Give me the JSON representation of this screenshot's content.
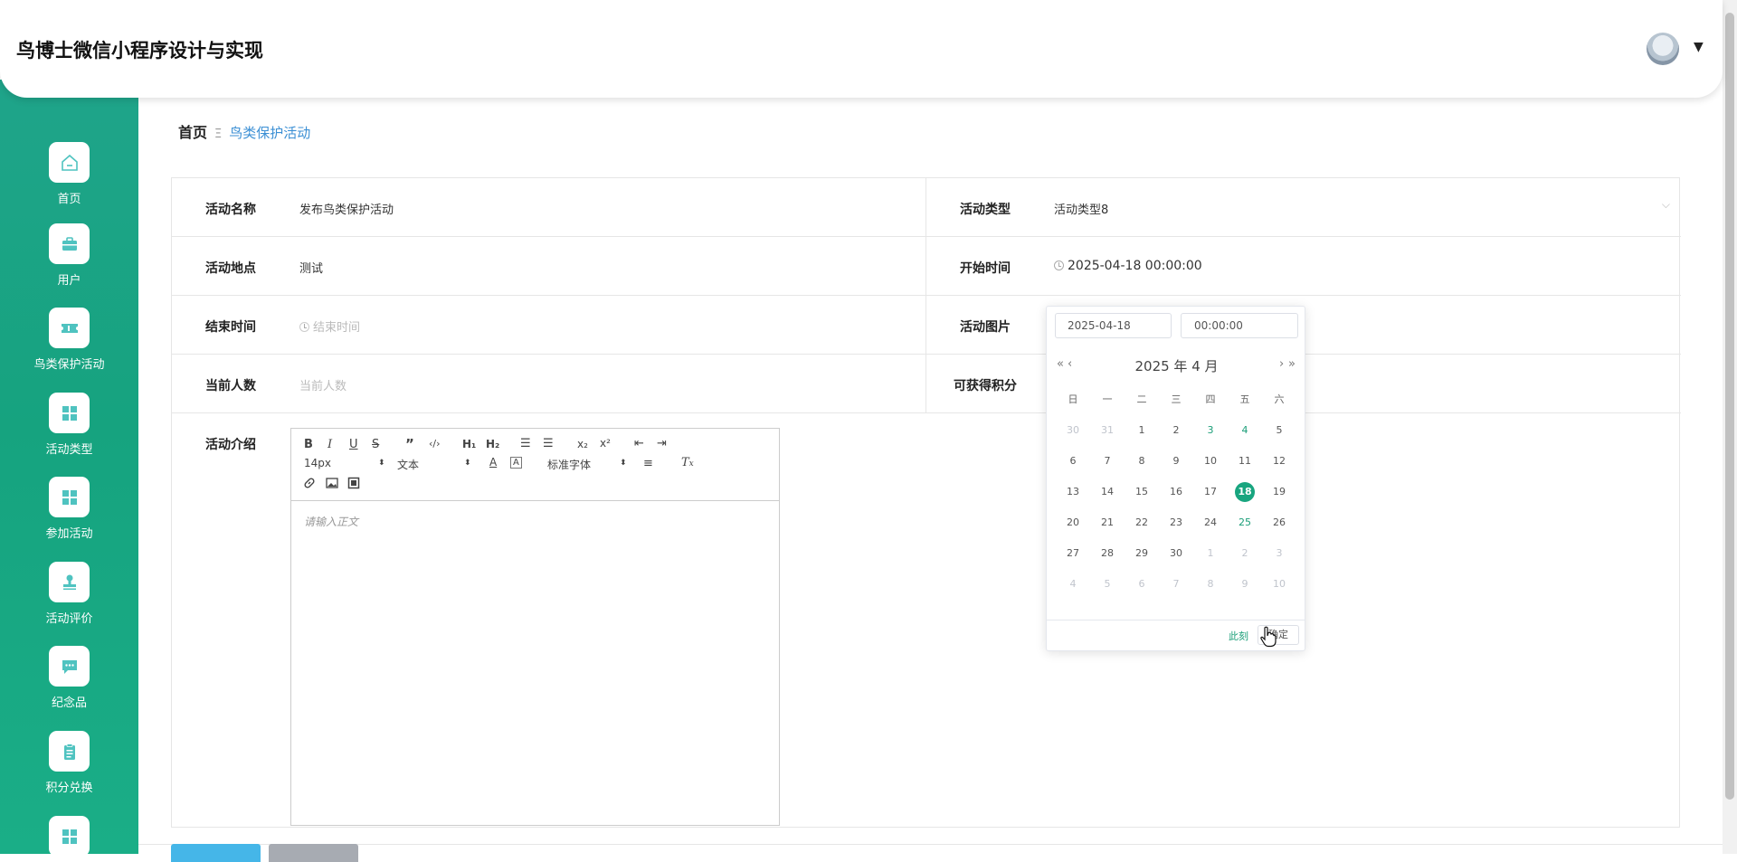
{
  "header": {
    "title": "鸟博士微信小程序设计与实现",
    "user_menu_caret": "▼"
  },
  "sidebar": {
    "items": [
      {
        "label": "首页",
        "icon": "home-icon"
      },
      {
        "label": "用户",
        "icon": "briefcase-icon"
      },
      {
        "label": "鸟类保护活动",
        "icon": "ticket-icon"
      },
      {
        "label": "活动类型",
        "icon": "grid-icon"
      },
      {
        "label": "参加活动",
        "icon": "grid-icon"
      },
      {
        "label": "活动评价",
        "icon": "stamp-icon"
      },
      {
        "label": "纪念品",
        "icon": "chat-icon"
      },
      {
        "label": "积分兑换",
        "icon": "clipboard-icon"
      },
      {
        "label": "",
        "icon": "grid-icon"
      }
    ]
  },
  "breadcrumb": {
    "home": "首页",
    "separator": "Ξ",
    "current": "鸟类保护活动"
  },
  "form": {
    "name_label": "活动名称",
    "name_value": "发布鸟类保护活动",
    "type_label": "活动类型",
    "type_value": "活动类型8",
    "location_label": "活动地点",
    "location_value": "测试",
    "start_label": "开始时间",
    "start_value": "2025-04-18 00:00:00",
    "end_label": "结束时间",
    "end_placeholder": "结束时间",
    "image_label": "活动图片",
    "count_label": "当前人数",
    "count_placeholder": "当前人数",
    "points_label": "可获得积分",
    "intro_label": "活动介绍"
  },
  "editor": {
    "size_value": "14px",
    "header_value": "文本",
    "font_value": "标准字体",
    "placeholder": "请输入正文"
  },
  "datepicker": {
    "date_input": "2025-04-18",
    "time_input": "00:00:00",
    "month_title": "2025 年  4 月",
    "prev_year": "«",
    "prev_month": "‹",
    "next_month": "›",
    "next_year": "»",
    "weekdays": [
      "日",
      "一",
      "二",
      "三",
      "四",
      "五",
      "六"
    ],
    "weeks": [
      [
        "30",
        "31",
        "1",
        "2",
        "3",
        "4",
        "5"
      ],
      [
        "6",
        "7",
        "8",
        "9",
        "10",
        "11",
        "12"
      ],
      [
        "13",
        "14",
        "15",
        "16",
        "17",
        "18",
        "19"
      ],
      [
        "20",
        "21",
        "22",
        "23",
        "24",
        "25",
        "26"
      ],
      [
        "27",
        "28",
        "29",
        "30",
        "1",
        "2",
        "3"
      ],
      [
        "4",
        "5",
        "6",
        "7",
        "8",
        "9",
        "10"
      ]
    ],
    "selected": "18",
    "now_label": "此刻",
    "ok_label": "确定",
    "accent_color": "#18a57f"
  }
}
